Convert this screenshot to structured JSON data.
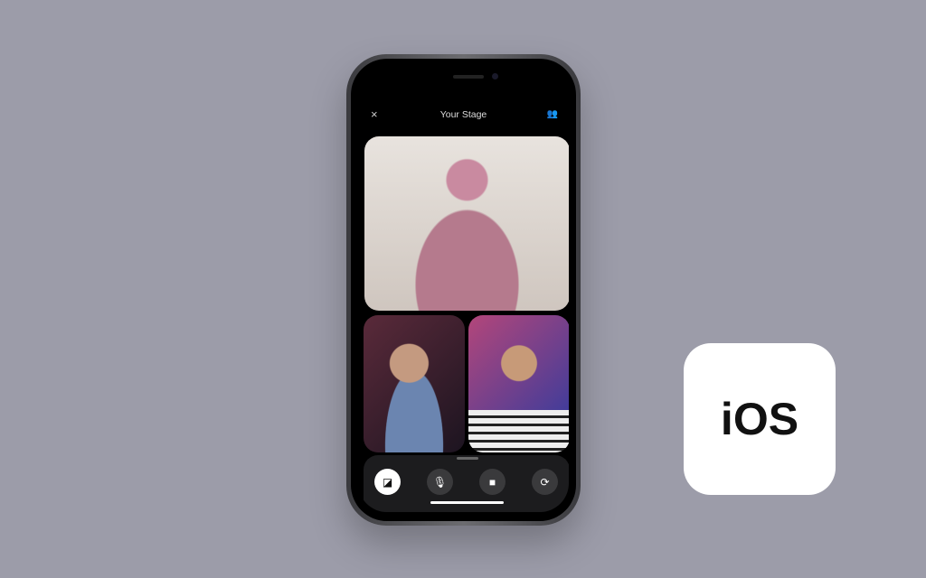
{
  "header": {
    "title": "Your Stage",
    "close_icon": "×",
    "participants_icon": "👥"
  },
  "controls": [
    {
      "name": "screen-share-off",
      "glyph": "◪",
      "active": true
    },
    {
      "name": "microphone",
      "glyph": "🎙"
    },
    {
      "name": "camera",
      "glyph": "■"
    },
    {
      "name": "flip-camera",
      "glyph": "⟳"
    }
  ],
  "badge": {
    "label": "iOS"
  }
}
